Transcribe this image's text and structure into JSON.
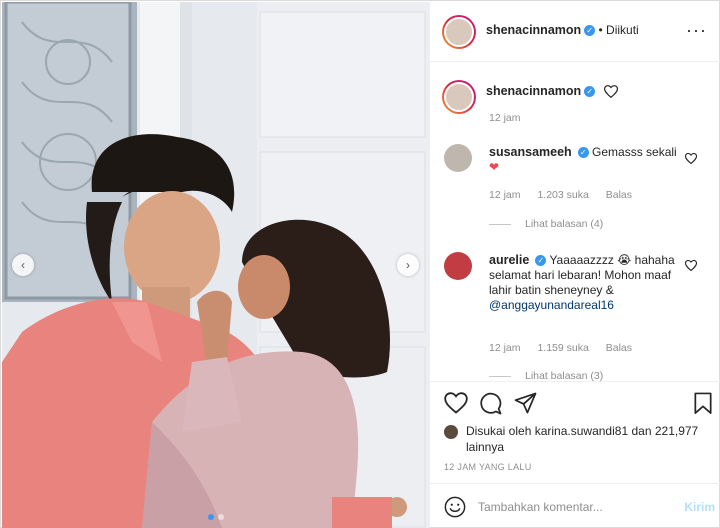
{
  "post": {
    "owner": "shenacinnamon",
    "follow_status": "• Diikuti",
    "caption_time": "12 jam"
  },
  "comments": [
    {
      "username": "susansameeh",
      "text": "Gemasss sekali",
      "emoji": "❤",
      "time": "12 jam",
      "likes": "1.203 suka",
      "reply_label": "Balas",
      "view_replies": "Lihat balasan (4)"
    },
    {
      "username": "aurelie",
      "text_line1": "Yaaaaazzzz",
      "emoji": "😭",
      "text_rest": "hahaha selamat hari lebaran! Mohon maaf lahir batin sheneyney &",
      "mention": "@anggayunandareal16",
      "time": "12 jam",
      "likes": "1.159 suka",
      "reply_label": "Balas",
      "view_replies": "Lihat balasan (3)"
    }
  ],
  "likes_summary": {
    "prefix": "Disukai oleh",
    "user": "karina.suwandi81",
    "joiner": "dan",
    "count": "221,977",
    "suffix": "lainnya"
  },
  "posted_ago": "12 JAM YANG LALU",
  "comment_input": {
    "placeholder": "Tambahkan komentar...",
    "post_label": "Kirim"
  },
  "colors": {
    "verified": "#3897f0",
    "accent": "#3897f0",
    "muted": "#8e8e8e",
    "heart": "#ed4956"
  },
  "icons": [
    "more-icon",
    "heart-icon",
    "comment-icon",
    "share-icon",
    "bookmark-icon",
    "emoji-icon",
    "verified-icon",
    "chevron-left-icon",
    "chevron-right-icon"
  ]
}
